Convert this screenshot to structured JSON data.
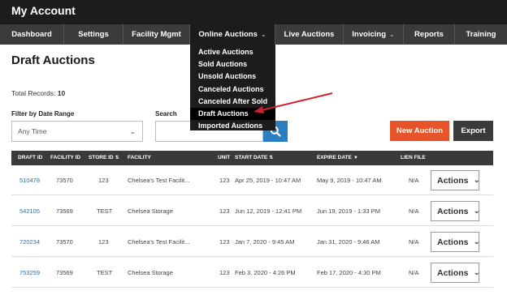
{
  "header": {
    "title": "My Account"
  },
  "nav": {
    "items": [
      {
        "label": "Dashboard"
      },
      {
        "label": "Settings"
      },
      {
        "label": "Facility Mgmt"
      },
      {
        "label": "Online Auctions"
      },
      {
        "label": "Live Auctions"
      },
      {
        "label": "Invoicing"
      },
      {
        "label": "Reports"
      },
      {
        "label": "Training"
      }
    ],
    "dropdown": [
      "Active Auctions",
      "Sold Auctions",
      "Unsold Auctions",
      "Canceled Auctions",
      "Canceled After Sold",
      "Draft Auctions",
      "Imported Auctions"
    ]
  },
  "page": {
    "title": "Draft Auctions",
    "total_label": "Total Records:",
    "total_value": "10"
  },
  "filters": {
    "date_label": "Filter by Date Range",
    "date_value": "Any Time",
    "search_label": "Search",
    "search_placeholder": ""
  },
  "buttons": {
    "new_auction": "New Auction",
    "export": "Export"
  },
  "table": {
    "headers": {
      "draft_id": "DRAFT ID",
      "facility_id": "FACILITY ID",
      "store_id": "STORE ID",
      "facility": "FACILITY",
      "unit": "UNIT",
      "start_date": "START DATE",
      "expire_date": "EXPIRE DATE",
      "lien_file": "LIEN FILE"
    },
    "actions_label": "Actions",
    "rows": [
      {
        "draft_id": "510478",
        "facility_id": "73570",
        "store_id": "123",
        "facility": "Chelsea's Test Facilit...",
        "unit": "123",
        "start_date": "Apr 25, 2019 - 10:47 AM",
        "expire_date": "May 9, 2019 - 10:47 AM",
        "lien_file": "N/A"
      },
      {
        "draft_id": "542105",
        "facility_id": "73569",
        "store_id": "TEST",
        "facility": "Chelsea Storage",
        "unit": "123",
        "start_date": "Jun 12, 2019 - 12:41 PM",
        "expire_date": "Jun 19, 2019 - 1:33 PM",
        "lien_file": "N/A"
      },
      {
        "draft_id": "720234",
        "facility_id": "73570",
        "store_id": "123",
        "facility": "Chelsea's Test Facilit...",
        "unit": "123",
        "start_date": "Jan 7, 2020 - 9:45 AM",
        "expire_date": "Jan 31, 2020 - 9:46 AM",
        "lien_file": "N/A"
      },
      {
        "draft_id": "753259",
        "facility_id": "73569",
        "store_id": "TEST",
        "facility": "Chelsea Storage",
        "unit": "123",
        "start_date": "Feb 3, 2020 - 4:26 PM",
        "expire_date": "Feb 17, 2020 - 4:30 PM",
        "lien_file": "N/A"
      }
    ]
  },
  "colors": {
    "accent": "#e8542a",
    "link": "#2c6fa8",
    "search_button": "#2a7fc2",
    "dark": "#1c1c1c",
    "arrow": "#d0202e"
  }
}
